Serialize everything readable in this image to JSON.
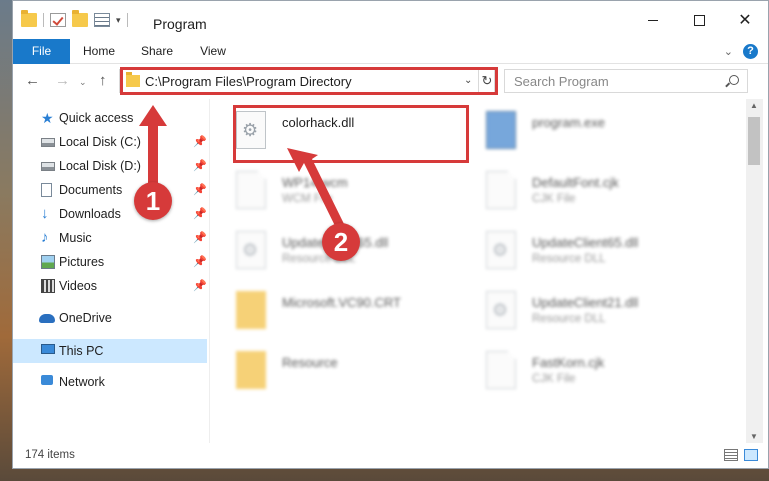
{
  "window": {
    "title": "Program"
  },
  "ribbon": {
    "tabs": [
      {
        "label": "File"
      },
      {
        "label": "Home"
      },
      {
        "label": "Share"
      },
      {
        "label": "View"
      }
    ]
  },
  "address": {
    "path": "C:\\Program Files\\Program Directory"
  },
  "search": {
    "placeholder": "Search Program"
  },
  "sidebar": {
    "items": [
      {
        "label": "Quick access",
        "icon": "star-icon"
      },
      {
        "label": "Local Disk (C:)",
        "icon": "drive-icon",
        "pinned": true
      },
      {
        "label": "Local Disk (D:)",
        "icon": "drive-icon",
        "pinned": true
      },
      {
        "label": "Documents",
        "icon": "documents-icon",
        "pinned": true
      },
      {
        "label": "Downloads",
        "icon": "download-icon",
        "pinned": true
      },
      {
        "label": "Music",
        "icon": "music-icon",
        "pinned": true
      },
      {
        "label": "Pictures",
        "icon": "pictures-icon",
        "pinned": true
      },
      {
        "label": "Videos",
        "icon": "videos-icon",
        "pinned": true
      },
      {
        "label": "OneDrive",
        "icon": "cloud-icon"
      },
      {
        "label": "This PC",
        "icon": "computer-icon",
        "selected": true
      },
      {
        "label": "Network",
        "icon": "network-icon"
      }
    ]
  },
  "files": [
    {
      "name": "colorhack.dll",
      "type": "",
      "icon": "dll-file-icon"
    },
    {
      "name": "program.exe",
      "type": "",
      "icon": "exe-file-icon"
    },
    {
      "name": "WP14.wcm",
      "type": "WCM File",
      "icon": "file-icon"
    },
    {
      "name": "DefaultFont.cjk",
      "type": "CJK File",
      "icon": "file-icon"
    },
    {
      "name": "UpdateClient65.dll",
      "type": "Resource DLL",
      "icon": "dll-file-icon"
    },
    {
      "name": "UpdateClient65.dll",
      "type": "Resource DLL",
      "icon": "dll-file-icon"
    },
    {
      "name": "Microsoft.VC90.CRT",
      "type": "",
      "icon": "folder-icon"
    },
    {
      "name": "UpdateClient21.dll",
      "type": "Resource DLL",
      "icon": "dll-file-icon"
    },
    {
      "name": "Resource",
      "type": "",
      "icon": "folder-icon"
    },
    {
      "name": "FastKorn.cjk",
      "type": "CJK File",
      "icon": "file-icon"
    }
  ],
  "status": {
    "items_count": "174 items"
  },
  "annotations": {
    "step1": "1",
    "step2": "2"
  },
  "colors": {
    "accent": "#1979ca",
    "highlight": "#d63a3a",
    "selection": "#cce8ff"
  }
}
